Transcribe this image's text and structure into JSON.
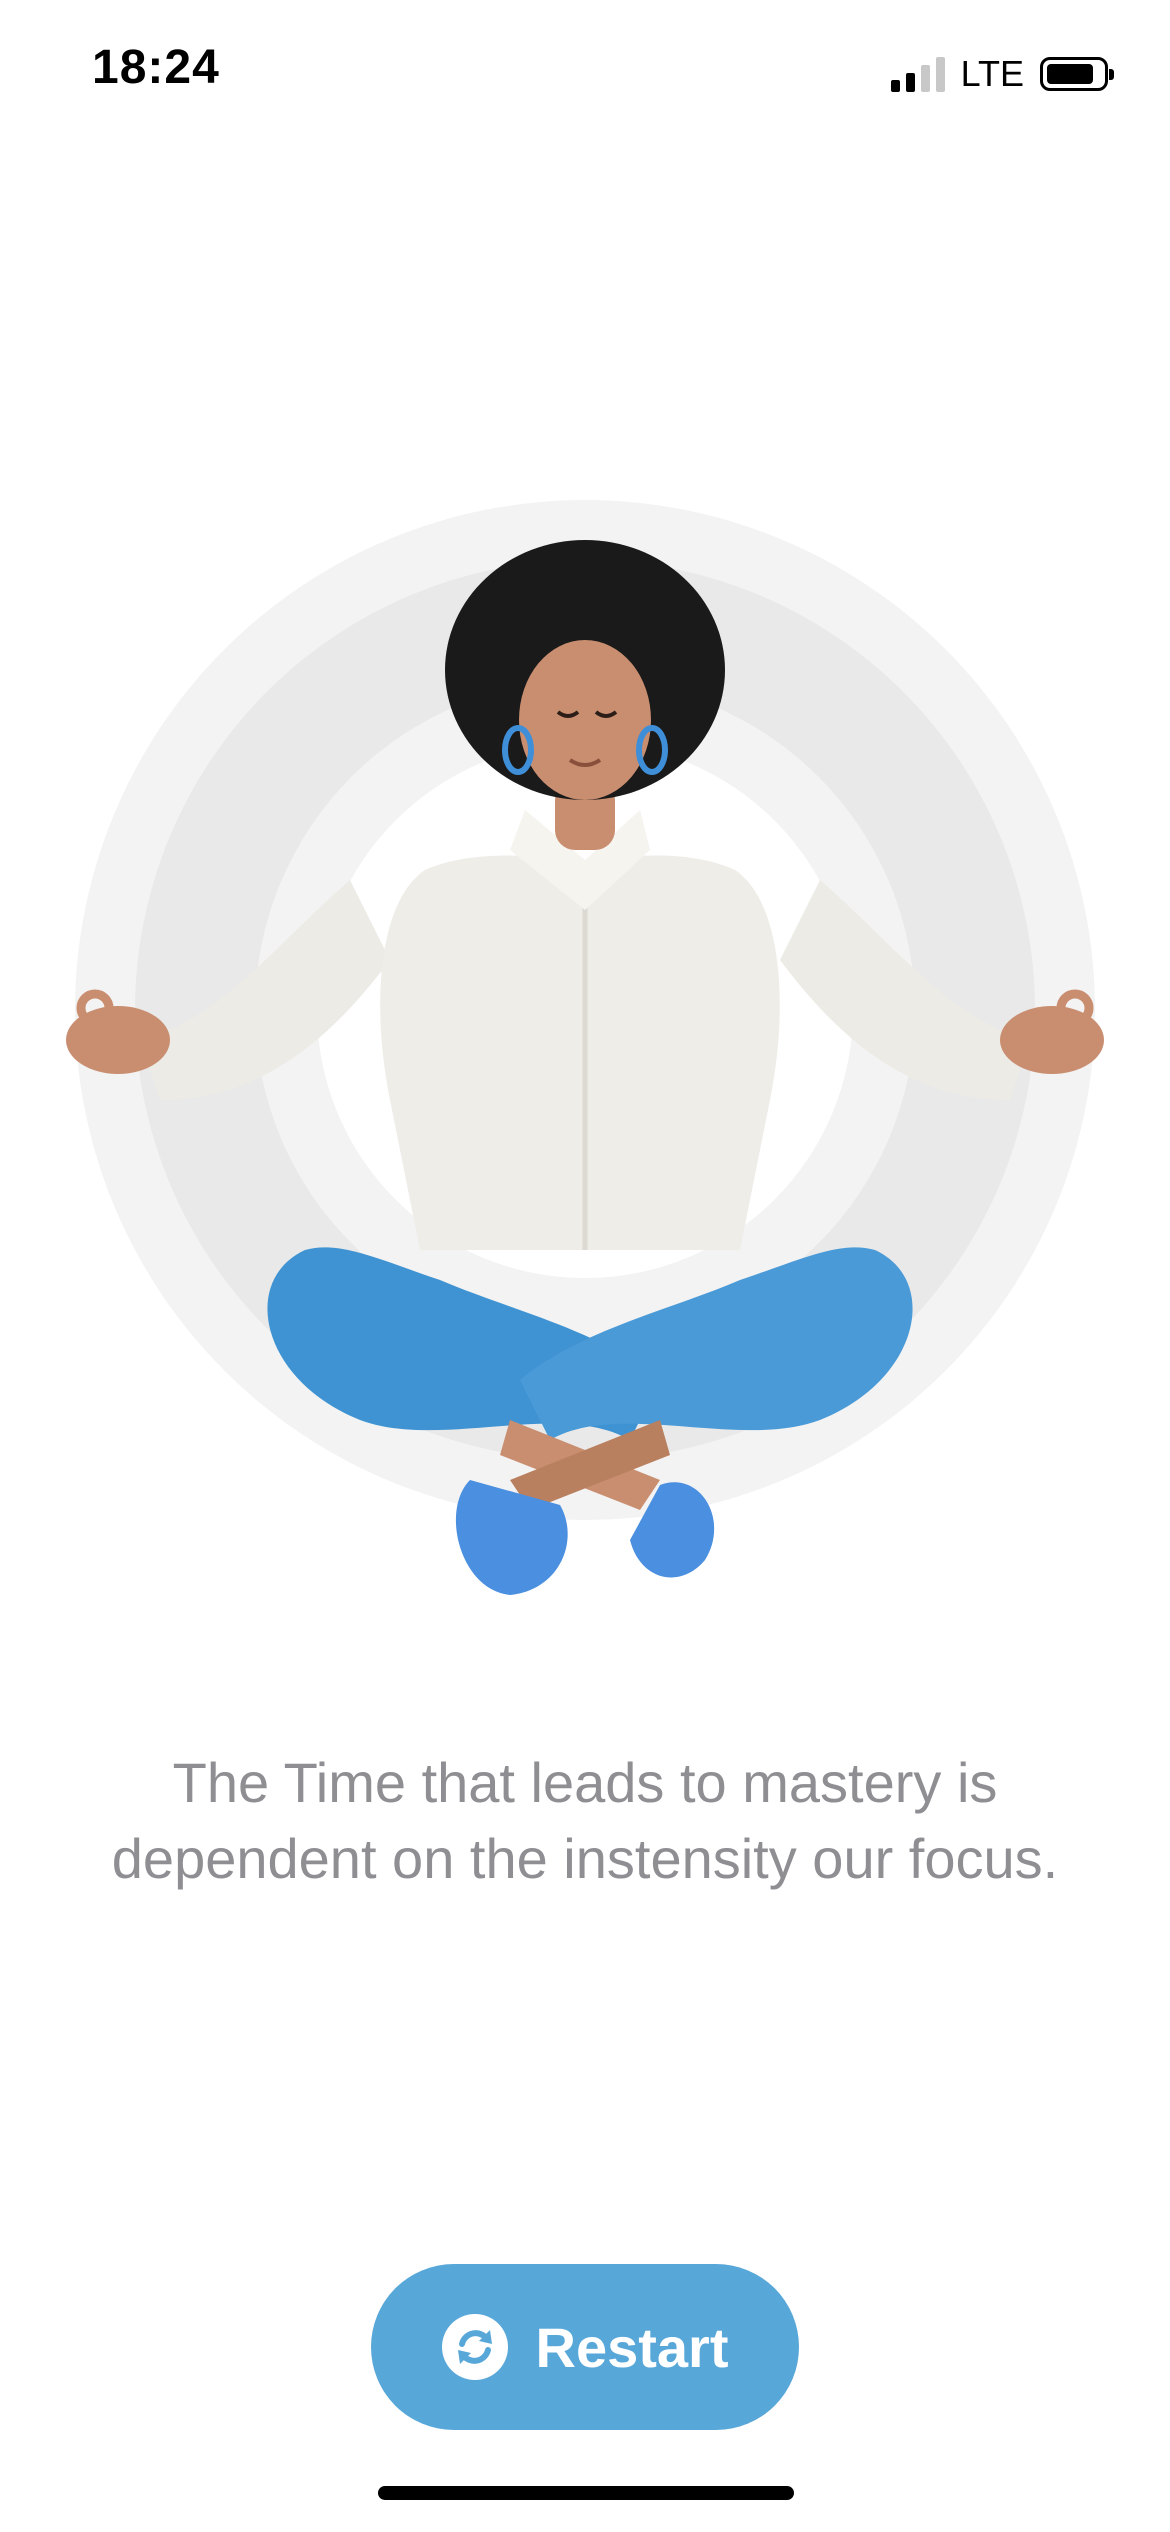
{
  "status_bar": {
    "time": "18:24",
    "network": "LTE",
    "signal_bars_active": 2,
    "signal_bars_total": 4,
    "battery_level": 0.85
  },
  "illustration": {
    "icon": "meditating-woman-illustration",
    "colors": {
      "ring_outer": "#f3f3f3",
      "ring_inner": "#e9e9e9",
      "shirt": "#efede8",
      "pants": "#3f93d2",
      "shoes": "#4a8fe0",
      "hair": "#1a1a1a",
      "skin": "#c98e70"
    }
  },
  "quote": {
    "line1": "The Time that leads to mastery is",
    "line2": "dependent on the instensity our focus."
  },
  "restart_button": {
    "label": "Restart",
    "icon": "refresh-icon",
    "color": "#58a7d9"
  }
}
